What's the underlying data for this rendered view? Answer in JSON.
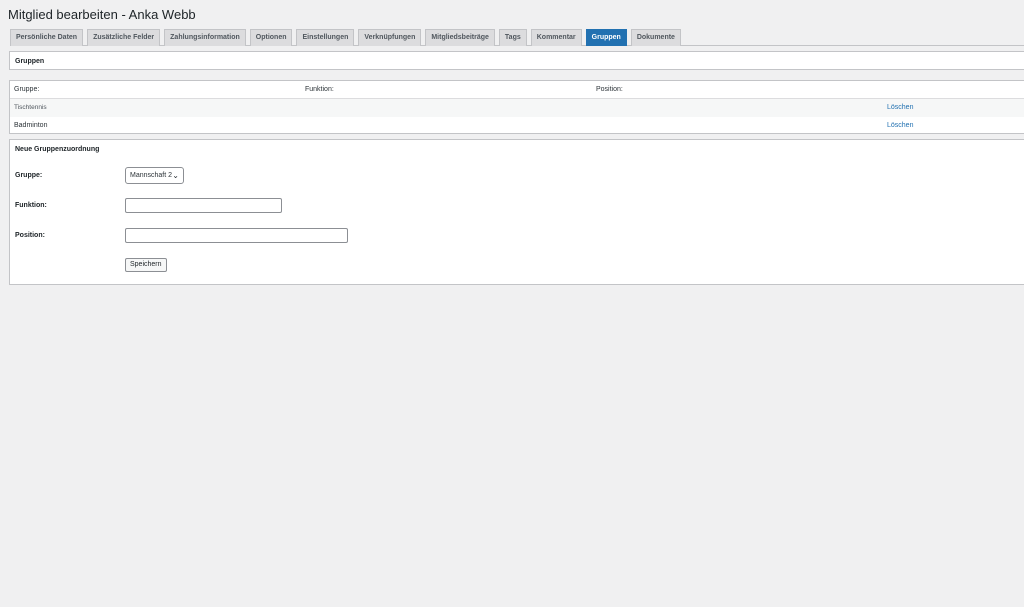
{
  "header": {
    "title": "Mitglied bearbeiten - Anka Webb"
  },
  "tabs": [
    {
      "label": "Persönliche Daten"
    },
    {
      "label": "Zusätzliche Felder"
    },
    {
      "label": "Zahlungsinformation"
    },
    {
      "label": "Optionen"
    },
    {
      "label": "Einstellungen"
    },
    {
      "label": "Verknüpfungen"
    },
    {
      "label": "Mitgliedsbeiträge"
    },
    {
      "label": "Tags"
    },
    {
      "label": "Kommentar"
    },
    {
      "label": "Gruppen",
      "active": true
    },
    {
      "label": "Dokumente"
    }
  ],
  "groups_panel": {
    "title": "Gruppen"
  },
  "groups_table": {
    "columns": [
      "Gruppe:",
      "Funktion:",
      "Position:"
    ],
    "rows": [
      {
        "group": "Tischtennis",
        "function": "",
        "position": "",
        "action": "Löschen"
      },
      {
        "group": "Badminton",
        "function": "",
        "position": "",
        "action": "Löschen"
      }
    ]
  },
  "new_assignment": {
    "title": "Neue Gruppenzuordnung",
    "group_label": "Gruppe:",
    "group_selected": "Mannschaft 2",
    "function_label": "Funktion:",
    "function_value": "",
    "position_label": "Position:",
    "position_value": "",
    "save_label": "Speichern"
  },
  "colors": {
    "accent": "#2271b1",
    "background": "#f0f0f1",
    "panel": "#ffffff",
    "border": "#c3c4c7"
  }
}
